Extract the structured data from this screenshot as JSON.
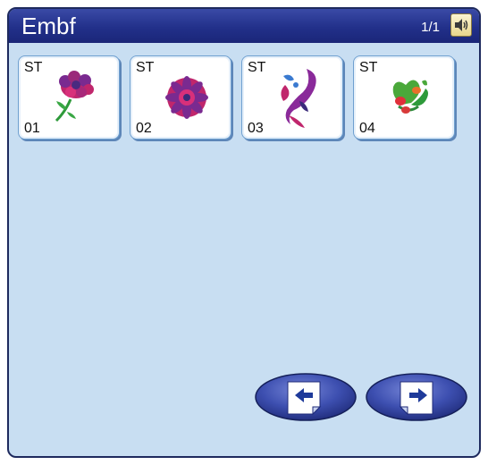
{
  "header": {
    "title": "Embf",
    "page_indicator": "1/1",
    "speaker_icon": "speaker-icon"
  },
  "designs": [
    {
      "type": "ST",
      "number": "01",
      "icon": "carnation-icon"
    },
    {
      "type": "ST",
      "number": "02",
      "icon": "round-flower-icon"
    },
    {
      "type": "ST",
      "number": "03",
      "icon": "paisley-flourish-icon"
    },
    {
      "type": "ST",
      "number": "04",
      "icon": "heart-flower-icon"
    }
  ],
  "navigation": {
    "prev_icon": "arrow-left-icon",
    "next_icon": "arrow-right-icon"
  },
  "colors": {
    "title_bar": "#22308a",
    "background": "#c8def2",
    "nav_button": "#3d4fb0"
  }
}
